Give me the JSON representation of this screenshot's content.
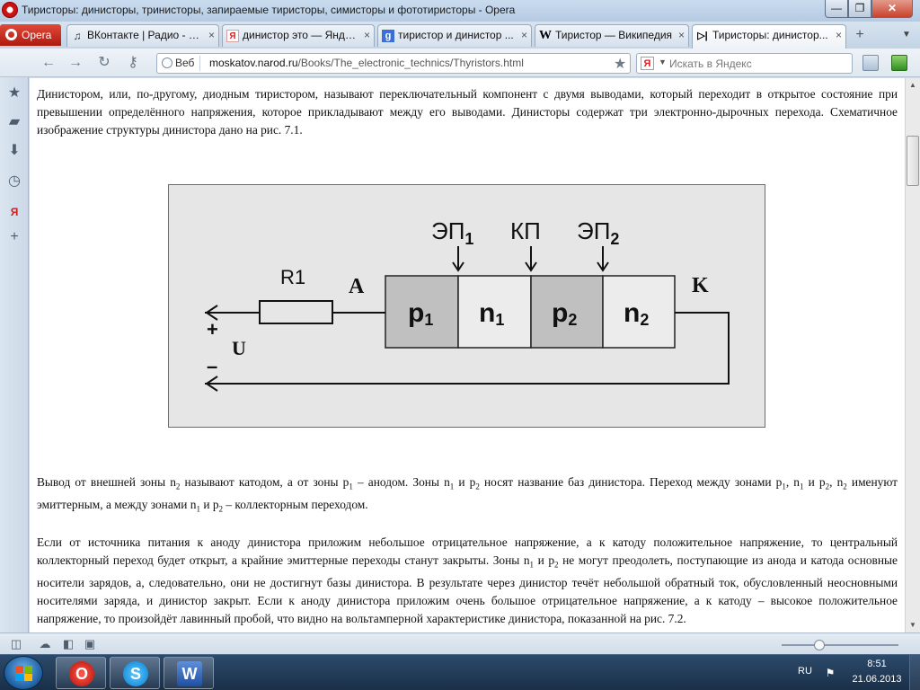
{
  "window": {
    "title": "Тиристоры: динисторы, тринисторы, запираемые тиристоры, симисторы и фототиристоры - Opera",
    "controls": {
      "minimize": "—",
      "maximize": "❐",
      "close": "✕"
    }
  },
  "browser": {
    "menu_label": "Opera",
    "tabs": [
      {
        "label": "ВКонтакте | Радио - Ру...",
        "icon": "vk-music-icon"
      },
      {
        "label": "динистор это — Яндек...",
        "icon": "yandex-icon"
      },
      {
        "label": "тиристор и динистор ...",
        "icon": "google-icon"
      },
      {
        "label": "Тиристор — Википедия",
        "icon": "wikipedia-icon"
      },
      {
        "label": "Тиристоры: динистор...",
        "icon": "diode-icon",
        "active": true
      }
    ],
    "address": {
      "badge": "Веб",
      "host": "moskatov.narod.ru",
      "path": "/Books/The_electronic_technics/Thyristors.html"
    },
    "search": {
      "engine": "Я",
      "placeholder": "Искать в Яндекс"
    }
  },
  "article": {
    "p1": "Динистором, или, по-другому, диодным тиристором, называют переключательный компонент с двумя выводами, который переходит в открытое состояние при превышении определённого напряжения, которое прикладывают между его выводами. Динисторы содержат три электронно-дырочных перехода. Схематичное изображение структуры динистора дано на рис. 7.1.",
    "p2": {
      "t1": "Вывод от внешней зоны n",
      "s1": "2",
      "t2": " называют катодом, а от зоны p",
      "s2": "1",
      "t3": " – анодом. Зоны n",
      "s3": "1",
      "t4": " и p",
      "s4": "2",
      "t5": " носят название баз динистора. Переход между зонами p",
      "s5": "1",
      "t6": ", n",
      "s6": "1",
      "t7": " и p",
      "s7": "2",
      "t8": ", n",
      "s8": "2",
      "t9": " именуют эмиттерным, а между зонами n",
      "s9": "1",
      "t10": " и p",
      "s10": "2",
      "t11": " – коллекторным переходом."
    },
    "p3": {
      "t1": "Если от источника питания к аноду динистора приложим небольшое отрицательное напряжение, а к катоду положительное напряжение, то центральный коллекторный переход будет открыт, а крайние эмиттерные переходы станут закрыты. Зоны n",
      "s1": "1",
      "t2": " и p",
      "s2": "2",
      "t3": " не могут преодолеть, поступающие из анода и катода основные носители зарядов, а, следовательно, они не достигнут базы динистора. В результате через динистор течёт небольшой обратный ток, обусловленный неосновными носителями заряда, и динистор закрыт. Если к аноду динистора приложим очень большое отрицательное напряжение, а к катоду – высокое положительное напряжение, то произойдёт лавинный пробой, что видно на вольтамперной характеристике динистора, показанной на рис. 7.2."
    },
    "figure": {
      "resistor": "R1",
      "anode": "A",
      "cathode": "K",
      "plus": "+",
      "minus": "–",
      "voltage": "U",
      "junction_labels": [
        {
          "base": "ЭП",
          "sub": "1"
        },
        {
          "base": "КП",
          "sub": ""
        },
        {
          "base": "ЭП",
          "sub": "2"
        }
      ],
      "zones": [
        {
          "base": "p",
          "sub": "1",
          "fill": "#c0c0c0"
        },
        {
          "base": "n",
          "sub": "1",
          "fill": "#ececec"
        },
        {
          "base": "p",
          "sub": "2",
          "fill": "#c0c0c0"
        },
        {
          "base": "n",
          "sub": "2",
          "fill": "#ececec"
        }
      ]
    }
  },
  "taskbar": {
    "language": "RU",
    "time": "8:51",
    "date": "21.06.2013",
    "apps": [
      "opera-icon",
      "skype-icon",
      "word-icon"
    ]
  },
  "colors": {
    "opera_red": "#cc1212",
    "zone_dark": "#c0c0c0",
    "zone_light": "#ececec",
    "figure_bg": "#e6e6e6"
  }
}
